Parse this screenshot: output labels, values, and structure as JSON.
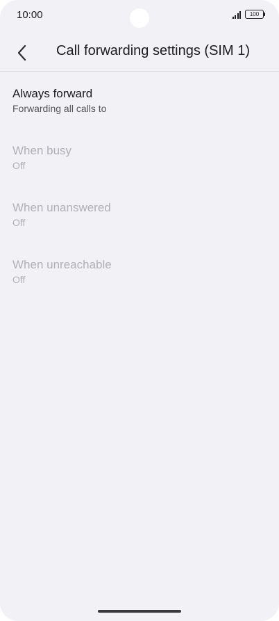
{
  "status_bar": {
    "time": "10:00",
    "battery": "100",
    "signal_icon": "signal-bars-icon",
    "battery_icon": "battery-icon"
  },
  "header": {
    "back_icon": "chevron-left-icon",
    "title": "Call forwarding settings (SIM 1)"
  },
  "settings": [
    {
      "title": "Always forward",
      "summary": "Forwarding all calls to",
      "enabled": true
    },
    {
      "title": "When busy",
      "summary": "Off",
      "enabled": false
    },
    {
      "title": "When unanswered",
      "summary": "Off",
      "enabled": false
    },
    {
      "title": "When unreachable",
      "summary": "Off",
      "enabled": false
    }
  ],
  "colors": {
    "background": "#f1f1f6",
    "text_primary": "#1c1c1e",
    "text_secondary": "#55555a",
    "text_disabled": "#b0b0b6"
  }
}
